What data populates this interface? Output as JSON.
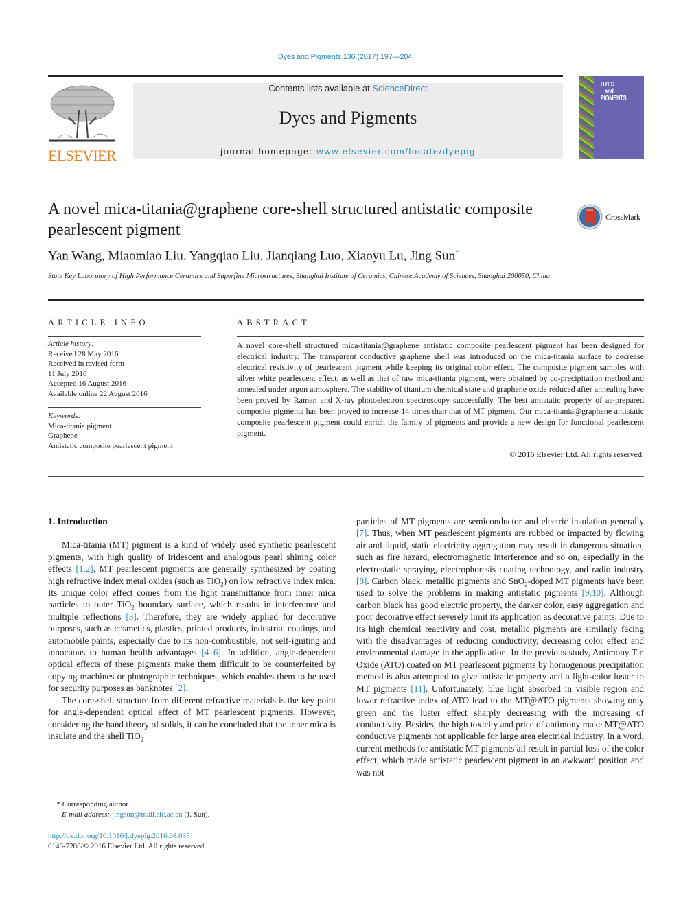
{
  "header": {
    "journal_ref": "Dyes and Pigments 136 (2017) 197—204",
    "contents_prefix": "Contents lists available at ",
    "contents_link": "ScienceDirect",
    "journal_title": "Dyes and Pigments",
    "homepage_prefix": "journal homepage: ",
    "homepage_link": "www.elsevier.com/locate/dyepig",
    "publisher_logo_text": "ELSEVIER",
    "cover_title_lines": [
      "DYES",
      "and",
      "PIGMENTS"
    ]
  },
  "article": {
    "title": "A novel mica-titania@graphene core-shell structured antistatic composite pearlescent pigment",
    "crossmark_label": "CrossMark",
    "authors": "Yan Wang, Miaomiao Liu, Yangqiao Liu, Jianqiang Luo, Xiaoyu Lu, Jing Sun",
    "corresponding_mark": "*",
    "affiliation": "State Key Laboratory of High Performance Ceramics and Superfine Microstructures, Shanghai Institute of Ceramics, Chinese Academy of Sciences, Shanghai 200050, China"
  },
  "article_info": {
    "heading": "ARTICLE INFO",
    "history_label": "Article history:",
    "history": [
      "Received 28 May 2016",
      "Received in revised form",
      "11 July 2016",
      "Accepted 16 August 2016",
      "Available online 22 August 2016"
    ],
    "keywords_label": "Keywords:",
    "keywords": [
      "Mica-titania pigment",
      "Graphene",
      "Antistatic composite pearlescent pigment"
    ]
  },
  "abstract": {
    "heading": "ABSTRACT",
    "text": "A novel core-shell structured mica-titania@graphene antistatic composite pearlescent pigment has been designed for electrical industry. The transparent conductive graphene shell was introduced on the mica-titania surface to decrease electrical resistivity of pearlescent pigment while keeping its original color effect. The composite pigment samples with silver white pearlescent effect, as well as that of raw mica-titania pigment, were obtained by co-precipitation method and annealed under argon atmosphere. The stability of titanium chemical state and graphene oxide reduced after annealing have been proved by Raman and X-ray photoelectron spectroscopy successfully. The best antistatic property of as-prepared composite pigments has been proved to increase 14 times than that of MT pigment. Our mica-titania@graphene antistatic composite pearlescent pigment could enrich the family of pigments and provide a new design for functional pearlescent pigment.",
    "copyright": "© 2016 Elsevier Ltd. All rights reserved."
  },
  "introduction": {
    "heading": "1.  Introduction",
    "left_p1": [
      {
        "t": "Mica-titania (MT) pigment is a kind of widely used synthetic pearlescent pigments, with high quality of iridescent and analogous pearl shining color effects "
      },
      {
        "ref": "[1,2]"
      },
      {
        "t": ". MT pearlescent pigments are generally synthesized by coating high refractive index metal oxides (such as TiO"
      },
      {
        "sub": "2"
      },
      {
        "t": ") on low refractive index mica. Its unique color effect comes from the light transmittance from inner mica particles to outer TiO"
      },
      {
        "sub": "2"
      },
      {
        "t": " boundary surface, which results in interference and multiple reflections "
      },
      {
        "ref": "[3]"
      },
      {
        "t": ". Therefore, they are widely applied for decorative purposes, such as cosmetics, plastics, printed products, industrial coatings, and automobile paints, especially due to its non-combustible, not self-igniting and innocuous to human health advantages "
      },
      {
        "ref": "[4–6]"
      },
      {
        "t": ". In addition, angle-dependent optical effects of these pigments make them difficult to be counterfeited by copying machines or photographic techniques, which enables them to be used for security purposes as banknotes "
      },
      {
        "ref": "[2]"
      },
      {
        "t": "."
      }
    ],
    "left_p2": [
      {
        "t": "The core-shell structure from different refractive materials is the key point for angle-dependent optical effect of MT pearlescent pigments. However, considering the band theory of solids, it can be concluded that the inner mica is insulate and the shell TiO"
      },
      {
        "sub": "2"
      }
    ],
    "right_p1": [
      {
        "t": "particles of MT pigments are semiconductor and electric insulation generally "
      },
      {
        "ref": "[7]"
      },
      {
        "t": ". Thus, when MT pearlescent pigments are rubbed or impacted by flowing air and liquid, static electricity aggregation may result in dangerous situation, such as fire hazard, electromagnetic interference and so on, especially in the electrostatic spraying, electrophoresis coating technology, and radio industry "
      },
      {
        "ref": "[8]"
      },
      {
        "t": ". Carbon black, metallic pigments and SnO"
      },
      {
        "sub": "2"
      },
      {
        "t": "-doped MT pigments have been used to solve the problems in making antistatic pigments "
      },
      {
        "ref": "[9,10]"
      },
      {
        "t": ". Although carbon black has good electric property, the darker color, easy aggregation and poor decorative effect severely limit its application as decorative paints. Due to its high chemical reactivity and cost, metallic pigments are similarly facing with the disadvantages of reducing conductivity, decreasing color effect and environmental damage in the application. In the previous study, Antimony Tin Oxide (ATO) coated on MT pearlescent pigments by homogenous precipitation method is also attempted to give antistatic property and a light-color luster to MT pigments "
      },
      {
        "ref": "[11]"
      },
      {
        "t": ". Unfortunately, blue light absorbed in visible region and lower refractive index of ATO lead to the MT@ATO pigments showing only green and the luster effect sharply decreasing with the increasing of conductivity. Besides, the high toxicity and price of antimony make MT@ATO conductive pigments not applicable for large area electrical industry. In a word, current methods for antistatic MT pigments all result in partial loss of the color effect, which made antistatic pearlescent pigment in an awkward position and was not"
      }
    ]
  },
  "footnote": {
    "mark": "*",
    "corresponding": "Corresponding author.",
    "email_label": "E-mail address: ",
    "email": "jingsun@mail.sic.ac.cn",
    "email_suffix": " (J. Sun)."
  },
  "doi": {
    "link": "http://dx.doi.org/10.1016/j.dyepig.2016.08.035",
    "issn_line": "0143-7208/© 2016 Elsevier Ltd. All rights reserved."
  }
}
